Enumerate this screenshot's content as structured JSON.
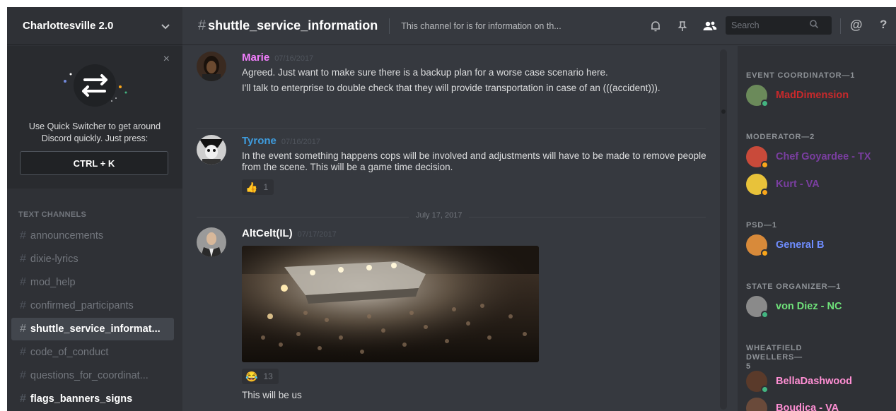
{
  "server": {
    "name": "Charlottesville 2.0",
    "chevron_icon": "chevron-down-icon"
  },
  "quick_switcher": {
    "close": "×",
    "text": "Use Quick Switcher to get around Discord quickly. Just press:",
    "shortcut": "CTRL + K"
  },
  "channels": {
    "section_title": "TEXT CHANNELS",
    "hash": "#",
    "items": [
      {
        "label": "announcements",
        "state": "normal"
      },
      {
        "label": "dixie-lyrics",
        "state": "normal"
      },
      {
        "label": "mod_help",
        "state": "normal"
      },
      {
        "label": "confirmed_participants",
        "state": "normal"
      },
      {
        "label": "shuttle_service_informat...",
        "state": "active"
      },
      {
        "label": "code_of_conduct",
        "state": "normal"
      },
      {
        "label": "questions_for_coordinat...",
        "state": "normal"
      },
      {
        "label": "flags_banners_signs",
        "state": "unread"
      }
    ]
  },
  "header": {
    "hash": "#",
    "channel_name": "shuttle_service_information",
    "topic": "This channel for is for information on th...",
    "search_placeholder": "Search",
    "at": "@",
    "help": "?"
  },
  "messages": [
    {
      "author": "Marie",
      "author_color": "#f47fff",
      "timestamp": "07/16/2017",
      "lines": [
        "Agreed. Just want to make sure there is a backup plan for a worse case scenario here.",
        "I'll talk to enterprise to double check that they will provide transportation in case of an (((accident)))."
      ]
    },
    {
      "author": "Tyrone",
      "author_color": "#3e9cde",
      "timestamp": "07/16/2017",
      "lines": [
        "In the event something happens cops will be involved and adjustments will have to be made to remove people from the scene. This will be a game time decision."
      ],
      "reaction": {
        "emoji": "👍",
        "count": "1"
      }
    },
    {
      "author": "AltCelt(IL)",
      "author_color": "#ffffff",
      "timestamp": "07/17/2017",
      "reaction": {
        "emoji": "😂",
        "count": "13"
      },
      "trailing_text": "This will be us"
    }
  ],
  "date_separator": "July 17, 2017",
  "members": {
    "roles": [
      {
        "title": "EVENT COORDINATOR—1",
        "people": [
          {
            "name": "MadDimension",
            "color": "#c9292b",
            "status": "#43b581"
          }
        ]
      },
      {
        "title": "MODERATOR—2",
        "people": [
          {
            "name": "Chef Goyardee - TX",
            "color": "#7a3ea0",
            "status": "#faa61a"
          },
          {
            "name": "Kurt - VA",
            "color": "#7a3ea0",
            "status": "#faa61a"
          }
        ]
      },
      {
        "title": "PSD—1",
        "people": [
          {
            "name": "General B",
            "color": "#6f8dff",
            "status": "#faa61a"
          }
        ]
      },
      {
        "title": "STATE ORGANIZER—1",
        "people": [
          {
            "name": "von Diez - NC",
            "color": "#6fe27a",
            "status": "#43b581"
          }
        ]
      },
      {
        "title": "WHEATFIELD DWELLERS—5",
        "people": [
          {
            "name": "BellaDashwood",
            "color": "#ff8fd4",
            "status": "#43b581"
          },
          {
            "name": "Boudica - VA",
            "color": "#ff8fd4",
            "status": "#43b581"
          }
        ]
      }
    ]
  }
}
